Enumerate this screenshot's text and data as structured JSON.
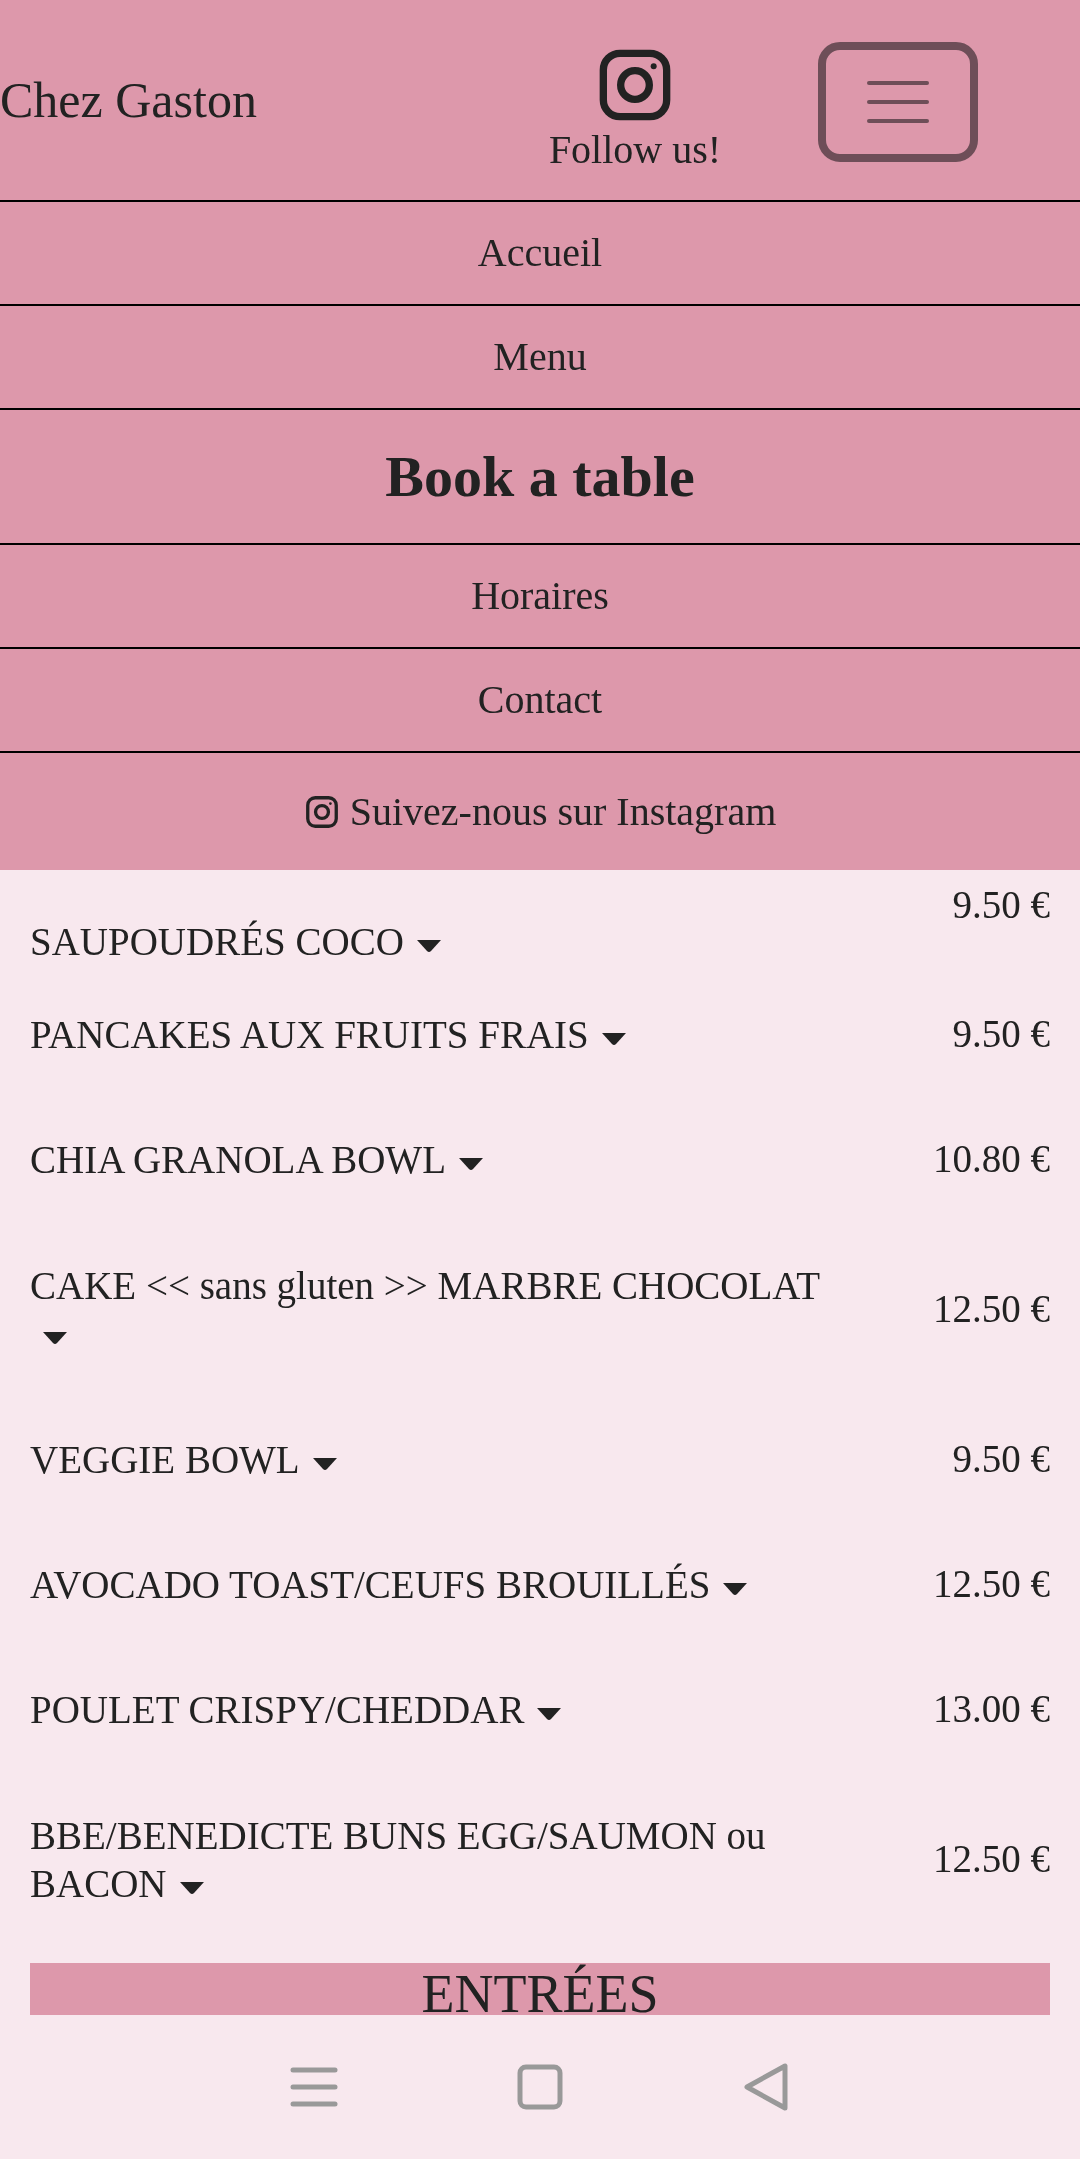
{
  "header": {
    "brand": "Chez Gaston",
    "follow": "Follow us!"
  },
  "nav": [
    {
      "label": "Accueil",
      "kind": "link"
    },
    {
      "label": "Menu",
      "kind": "link"
    },
    {
      "label": "Book a table",
      "kind": "cta"
    },
    {
      "label": "Horaires",
      "kind": "link"
    },
    {
      "label": "Contact",
      "kind": "link"
    }
  ],
  "instagram_link": "Suivez-nous sur Instagram",
  "menu_items": [
    {
      "name": "SAUPOUDRÉS COCO",
      "price": "9.50 €",
      "kind": "partial"
    },
    {
      "name": "PANCAKES AUX FRUITS FRAIS",
      "price": "9.50 €",
      "kind": "single"
    },
    {
      "name": "CHIA GRANOLA BOWL",
      "price": "10.80 €",
      "kind": "single"
    },
    {
      "name": "CAKE << sans gluten >> MARBRE CHOCOLAT",
      "price": "12.50 €",
      "kind": "double"
    },
    {
      "name": "VEGGIE BOWL",
      "price": "9.50 €",
      "kind": "single"
    },
    {
      "name": "AVOCADO TOAST/CEUFS BROUILLÉS",
      "price": "12.50 €",
      "kind": "single"
    },
    {
      "name": "POULET CRISPY/CHEDDAR",
      "price": "13.00 €",
      "kind": "single"
    },
    {
      "name": "BBE/BENEDICTE BUNS EGG/SAUMON ou BACON",
      "price": "12.50 €",
      "kind": "double"
    }
  ],
  "section_heading": "ENTRÉES"
}
